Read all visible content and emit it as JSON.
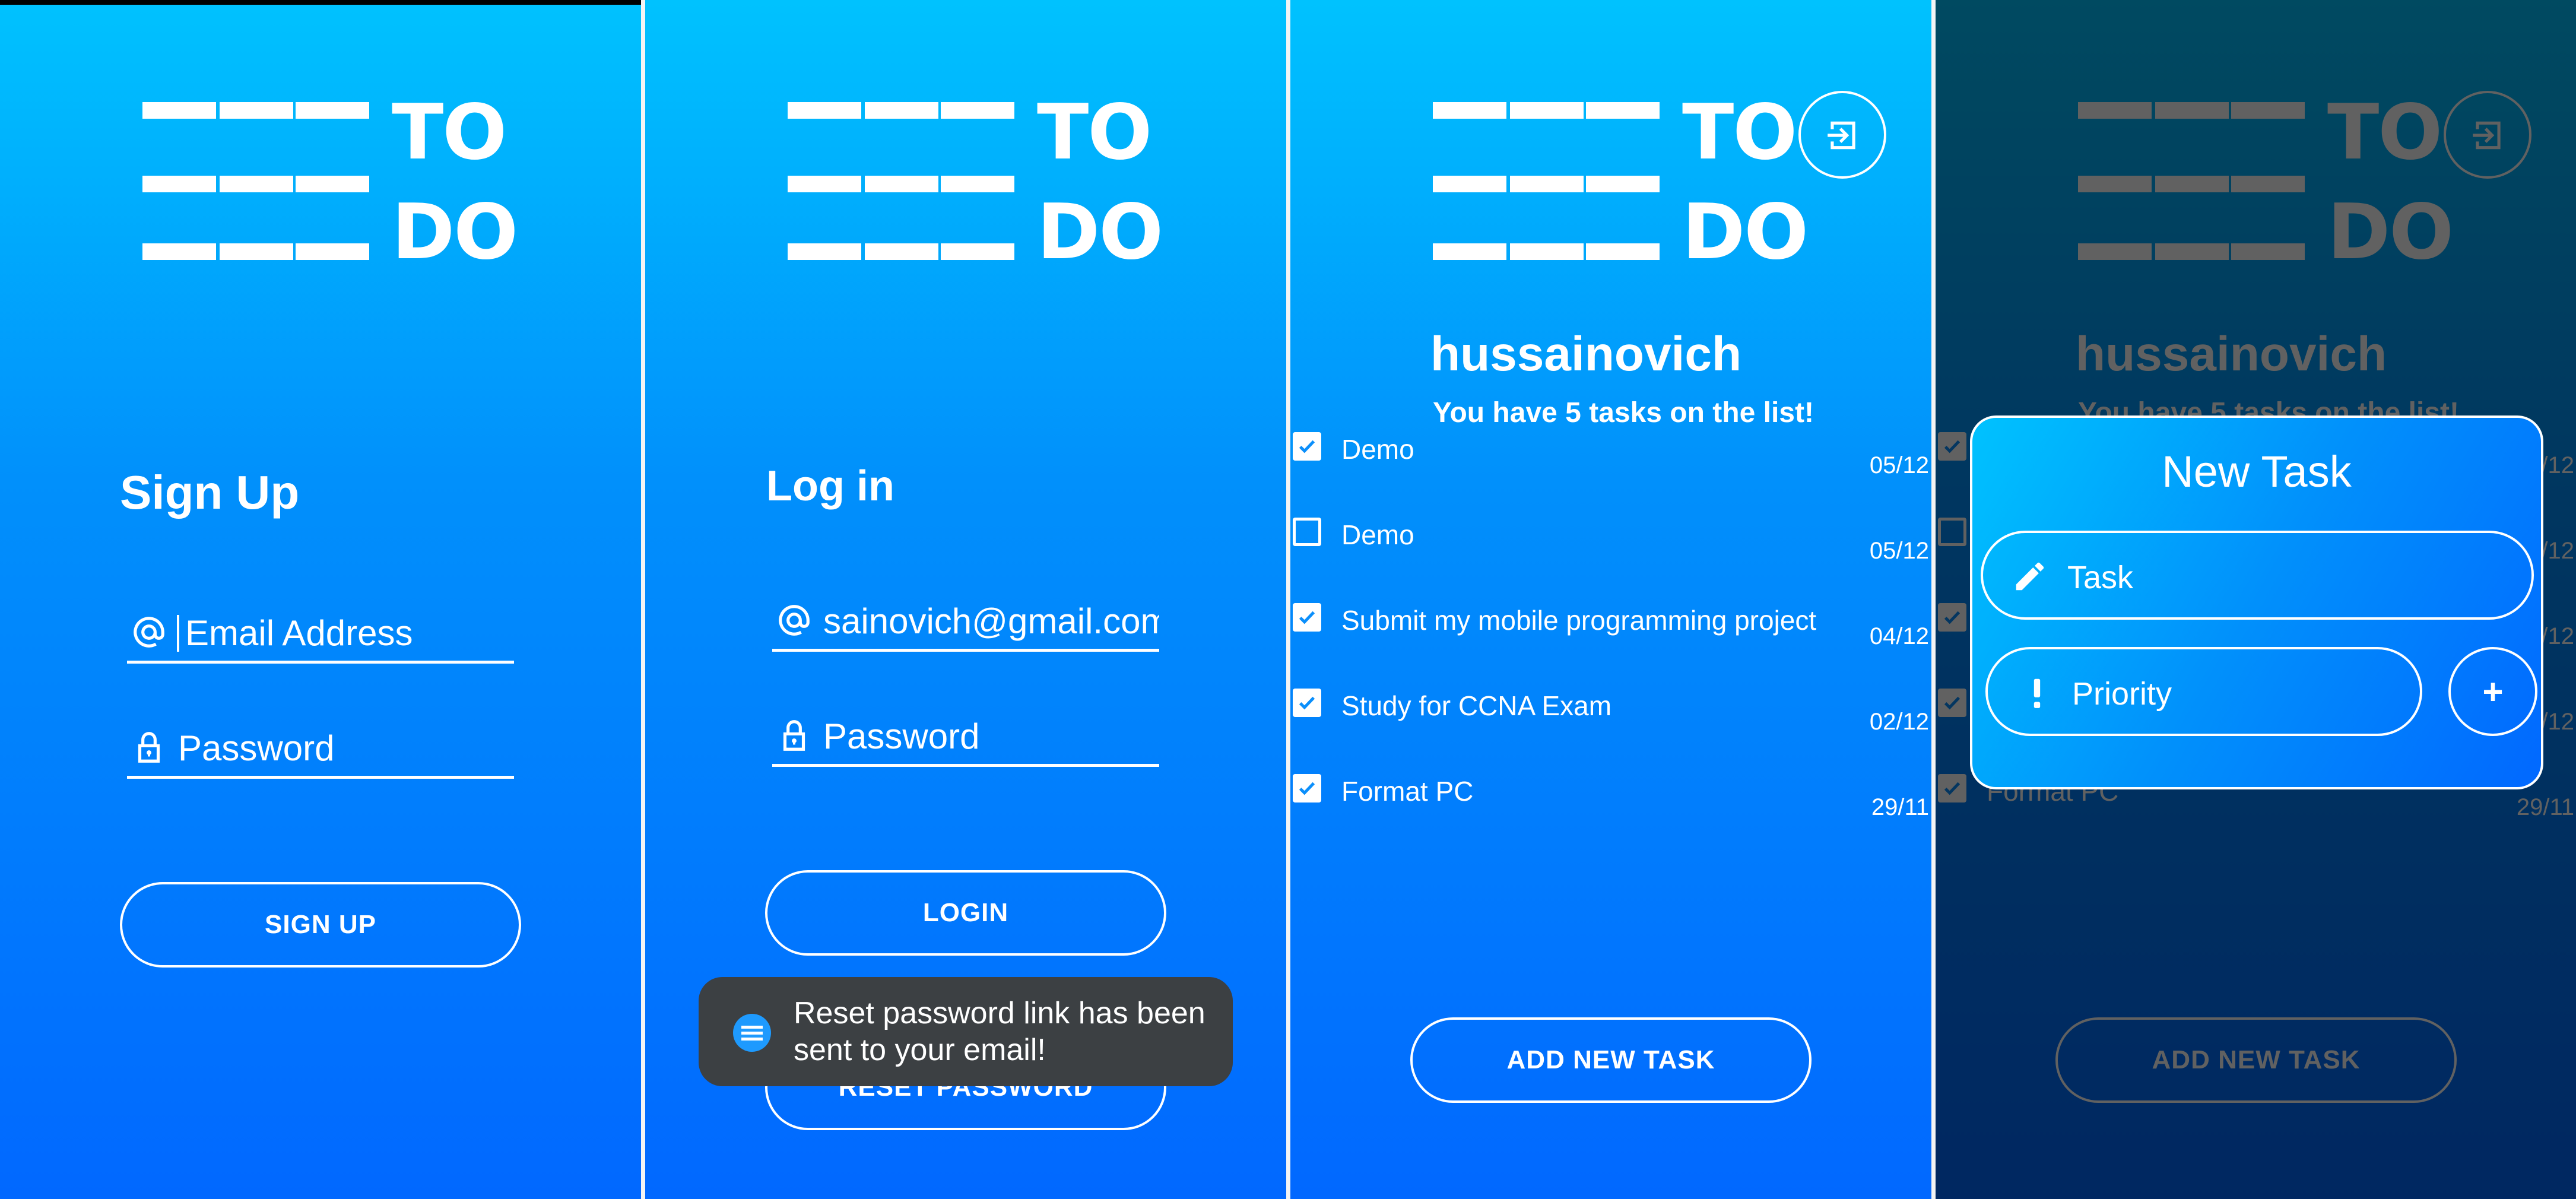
{
  "logo": {
    "line1": "TO",
    "line2": "DO"
  },
  "signup": {
    "title": "Sign Up",
    "email_placeholder": "Email Address",
    "password_placeholder": "Password",
    "button": "SIGN UP"
  },
  "login": {
    "title": "Log in",
    "email_value": "sainovich@gmail.com",
    "password_placeholder": "Password",
    "login_button": "LOGIN",
    "reset_button": "RESET PASSWORD",
    "toast": "Reset password link has been sent to your email!"
  },
  "tasks": {
    "username": "hussainovich",
    "count_text": "You have 5 tasks on the list!",
    "items": [
      {
        "name": "Demo",
        "date": "05/12",
        "done": true
      },
      {
        "name": "Demo",
        "date": "05/12",
        "done": false
      },
      {
        "name": "Submit my mobile programming project",
        "date": "04/12",
        "done": true
      },
      {
        "name": "Study for CCNA Exam",
        "date": "02/12",
        "done": true
      },
      {
        "name": "Format PC",
        "date": "29/11",
        "done": true
      }
    ],
    "add_button": "ADD NEW TASK"
  },
  "new_task_dialog": {
    "title": "New Task",
    "task_placeholder": "Task",
    "priority_placeholder": "Priority",
    "add_symbol": "+"
  },
  "colors": {
    "gradient_top": "#00c2fe",
    "gradient_bottom": "#0168ff",
    "toast_bg": "#3c4043"
  }
}
